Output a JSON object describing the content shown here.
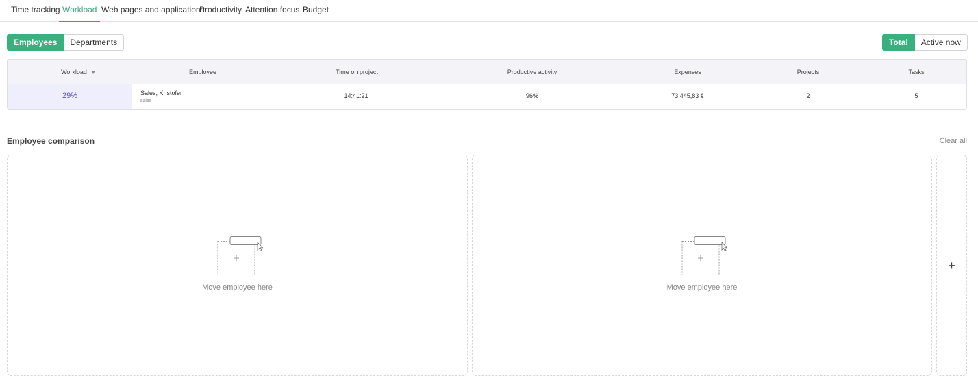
{
  "tabs": [
    "Time tracking",
    "Workload",
    "Web pages and applications",
    "Productivity",
    "Attention focus",
    "Budget"
  ],
  "active_tab": "Workload",
  "view_toggle": {
    "employees": "Employees",
    "departments": "Departments",
    "selected": "Employees"
  },
  "time_toggle": {
    "total": "Total",
    "active_now": "Active now",
    "selected": "Total"
  },
  "table": {
    "headers": {
      "workload": "Workload",
      "employee": "Employee",
      "time_on_project": "Time on project",
      "productive_activity": "Productive activity",
      "expenses": "Expenses",
      "projects": "Projects",
      "tasks": "Tasks"
    },
    "sorted_by": "Workload",
    "rows": [
      {
        "workload": "29%",
        "employee_name": "Sales, Kristofer",
        "employee_department": "sales",
        "time_on_project": "14:41:21",
        "productive_activity": "96%",
        "expenses": "73 445,83 €",
        "projects": "2",
        "tasks": "5"
      }
    ]
  },
  "comparison": {
    "title": "Employee comparison",
    "clear_all": "Clear all",
    "dropzones": [
      {
        "label": "Move employee here"
      },
      {
        "label": "Move employee here"
      }
    ],
    "add_symbol": "+"
  },
  "colors": {
    "accent": "#3ab07f",
    "workload_bg": "#efeefd",
    "workload_text": "#5a4fcf"
  },
  "icons": [
    "sort-down-icon",
    "drag-employee-icon",
    "plus-icon"
  ]
}
